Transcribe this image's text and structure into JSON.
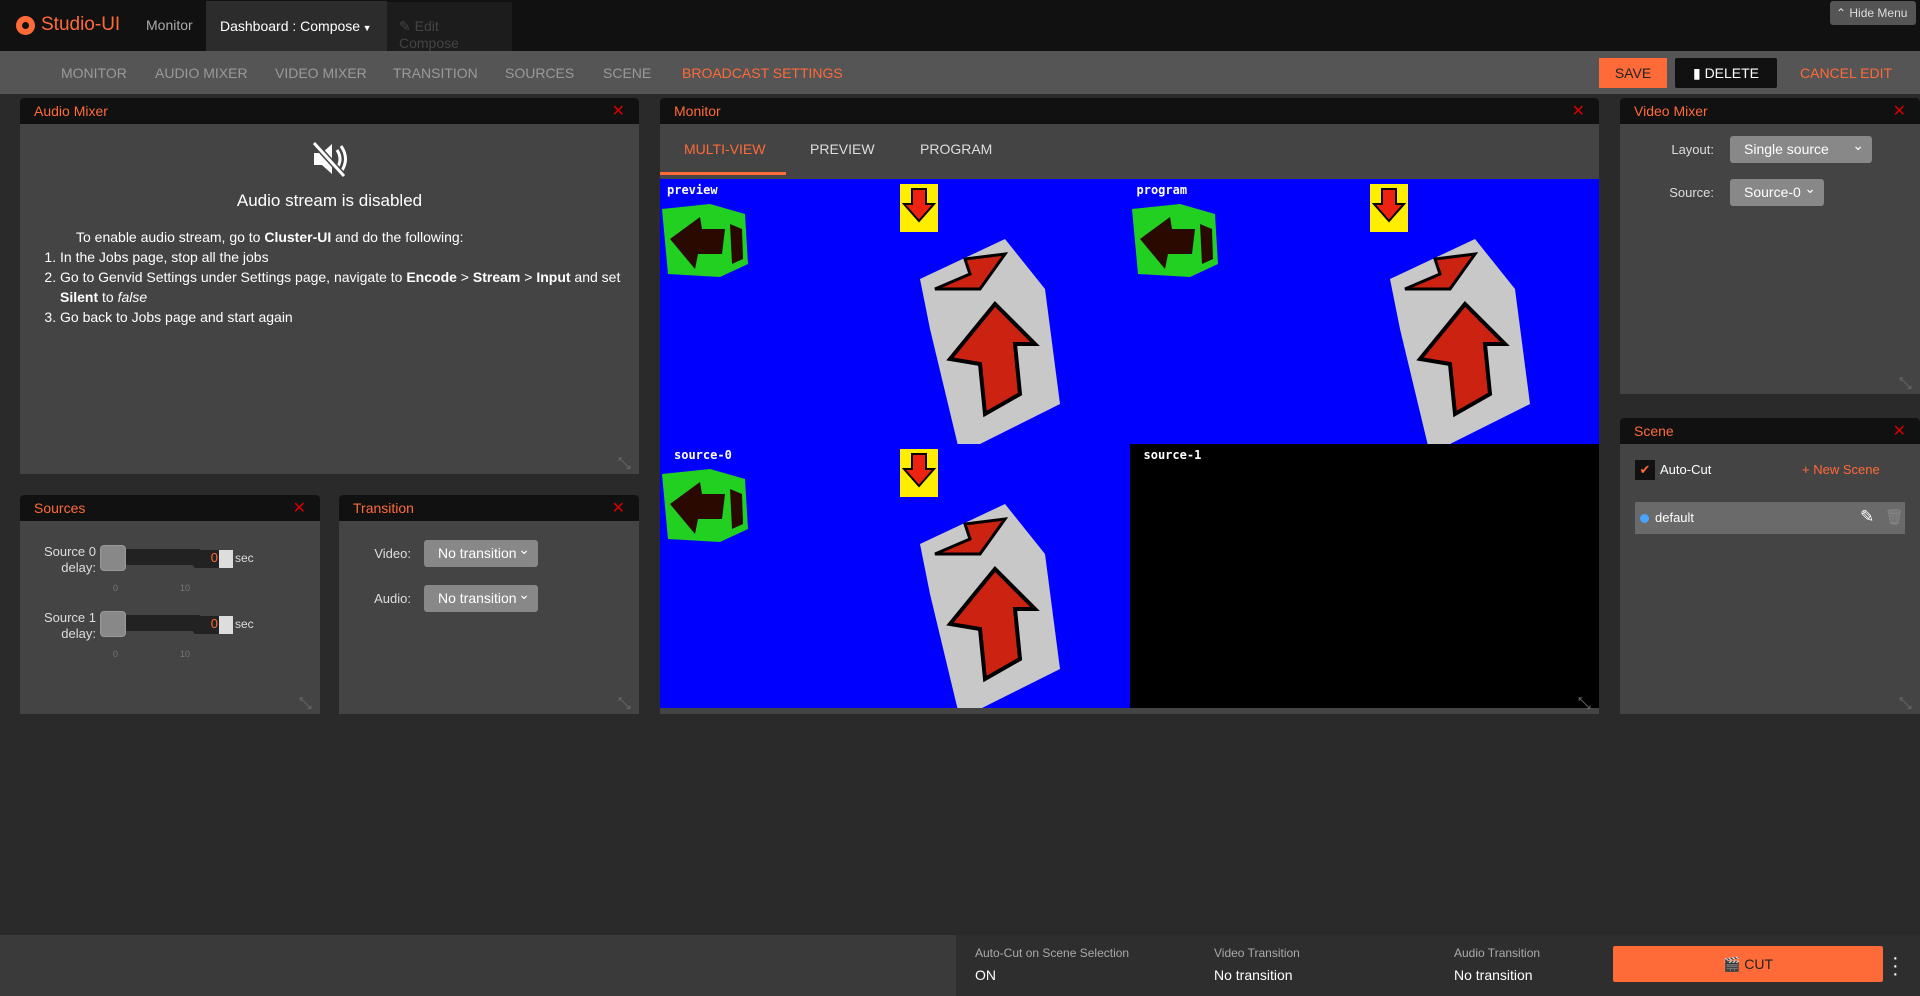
{
  "app": {
    "name": "Studio-UI",
    "nav_monitor": "Monitor",
    "dashboard": "Dashboard : Compose",
    "edit_compose": "Edit Compose",
    "hide_menu": "Hide Menu"
  },
  "menu": {
    "items": [
      "MONITOR",
      "AUDIO MIXER",
      "VIDEO MIXER",
      "TRANSITION",
      "SOURCES",
      "SCENE",
      "BROADCAST SETTINGS"
    ],
    "active": "BROADCAST SETTINGS",
    "save": "SAVE",
    "delete": "DELETE",
    "cancel": "CANCEL EDIT"
  },
  "colors": {
    "accent": "#ff6a39",
    "close": "#d40000",
    "video_bg": "#0000ff"
  },
  "audio_mixer": {
    "title": "Audio Mixer",
    "message": "Audio stream is disabled",
    "intro_a": "To enable audio stream, go to ",
    "intro_b": "Cluster-UI",
    "intro_c": " and do the following:",
    "step1": "In the Jobs page, stop all the jobs",
    "step2_a": "Go to Genvid Settings under Settings page, navigate to ",
    "step2_b": "Encode",
    "step2_sep": " > ",
    "step2_c": "Stream",
    "step2_d": "Input",
    "step2_e": " and set ",
    "step2_f": "Silent",
    "step2_g": " to ",
    "step2_h": "false",
    "step3": "Go back to Jobs page and start again"
  },
  "monitor": {
    "title": "Monitor",
    "tabs": [
      "MULTI-VIEW",
      "PREVIEW",
      "PROGRAM"
    ],
    "active_tab": "MULTI-VIEW",
    "views": [
      "preview",
      "program",
      "source-0",
      "source-1"
    ]
  },
  "video_mixer": {
    "title": "Video Mixer",
    "layout_label": "Layout:",
    "layout_value": "Single source",
    "source_label": "Source:",
    "source_value": "Source-0"
  },
  "scene": {
    "title": "Scene",
    "autocut_label": "Auto-Cut",
    "autocut_checked": true,
    "new_scene": "+ New Scene",
    "items": [
      {
        "name": "default"
      }
    ]
  },
  "sources": {
    "title": "Sources",
    "rows": [
      {
        "label_a": "Source 0",
        "label_b": "delay:",
        "value": "0",
        "unit": "sec",
        "min": "0",
        "max": "10"
      },
      {
        "label_a": "Source 1",
        "label_b": "delay:",
        "value": "0",
        "unit": "sec",
        "min": "0",
        "max": "10"
      }
    ]
  },
  "transition": {
    "title": "Transition",
    "video_label": "Video:",
    "video_value": "No transition",
    "audio_label": "Audio:",
    "audio_value": "No transition"
  },
  "bottom": {
    "autocut_label": "Auto-Cut on Scene Selection",
    "autocut_value": "ON",
    "video_label": "Video Transition",
    "video_value": "No transition",
    "audio_label": "Audio Transition",
    "audio_value": "No transition",
    "cut": "CUT"
  }
}
